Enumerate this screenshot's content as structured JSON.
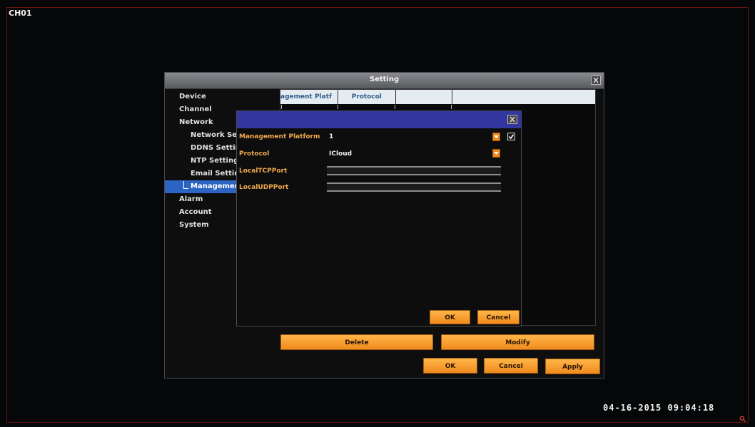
{
  "channel_label": "CH01",
  "datetime": "04-16-2015 09:04:18",
  "settings": {
    "title": "Setting",
    "nav": {
      "device": "Device",
      "channel": "Channel",
      "network": "Network",
      "network_settings": "Network Setti",
      "ddns_settings": "DDNS Settin",
      "ntp_settings": "NTP Setting",
      "email_settings": "Email Settin",
      "management": "Managemen",
      "alarm": "Alarm",
      "account": "Account",
      "system": "System"
    },
    "table_headers": [
      "agement Platf",
      "Protocol",
      "",
      ""
    ],
    "delete_label": "Delete",
    "modify_label": "Modify",
    "ok_label": "OK",
    "cancel_label": "Cancel",
    "apply_label": "Apply"
  },
  "dialog": {
    "management_platform_label": "Management Platform",
    "management_platform_value": "1",
    "management_platform_enabled": true,
    "protocol_label": "Protocol",
    "protocol_value": "ICloud",
    "local_tcp_port_label": "LocalTCPPort",
    "local_tcp_port_value": "",
    "local_udp_port_label": "LocalUDPPort",
    "local_udp_port_value": "",
    "ok_label": "OK",
    "cancel_label": "Cancel"
  },
  "colors": {
    "accent_orange": "#f08a1c",
    "selection_blue": "#2b64c2",
    "dialog_title_blue": "#3436a0",
    "field_label_orange": "#f2a84e"
  }
}
